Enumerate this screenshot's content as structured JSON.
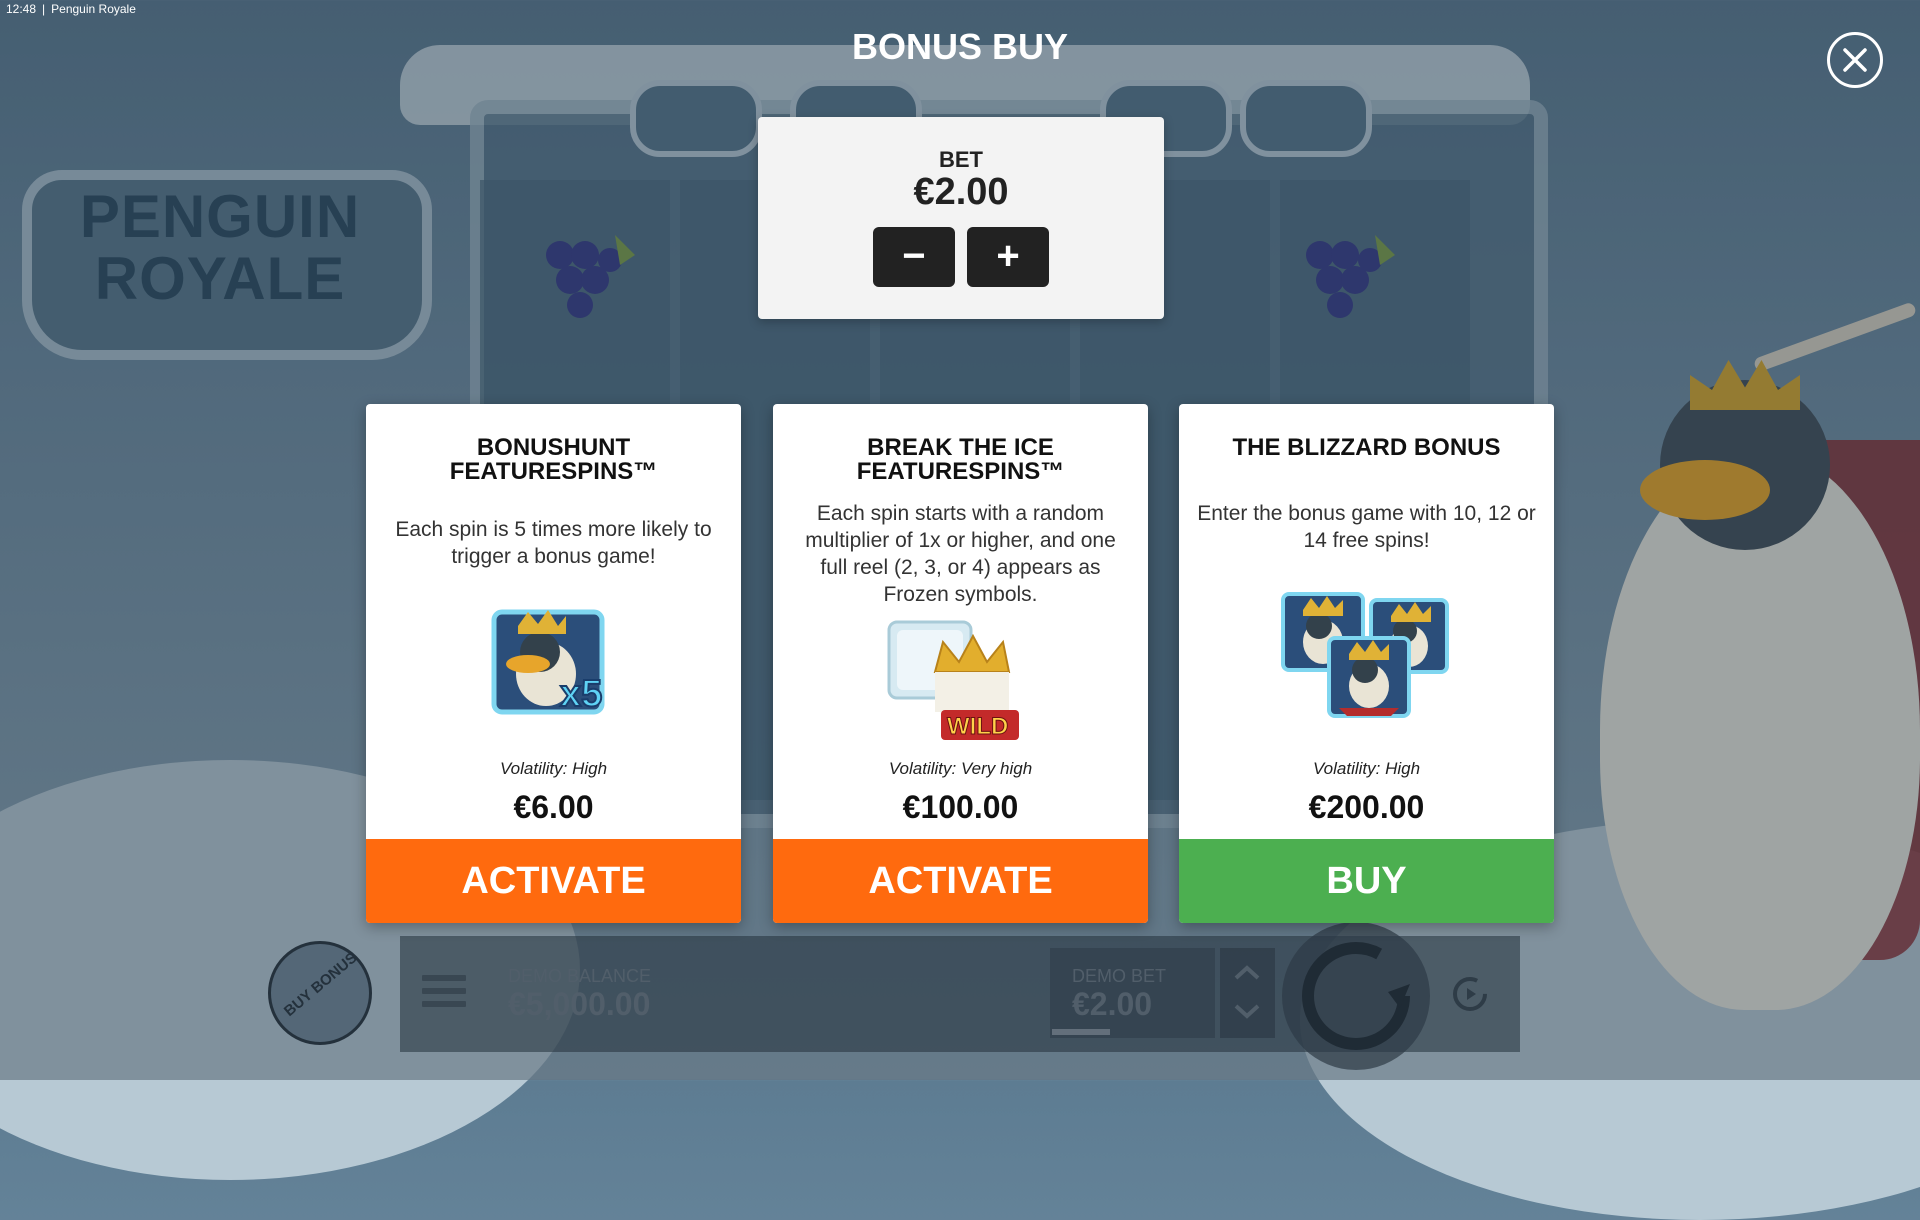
{
  "status_bar": {
    "time": "12:48",
    "separator": "|",
    "app_name": "Penguin Royale"
  },
  "background": {
    "logo_text": "PENGUIN ROYALE"
  },
  "modal": {
    "title": "BONUS BUY",
    "bet": {
      "label": "BET",
      "value": "€2.00",
      "decrease": "−",
      "increase": "+"
    },
    "cards": [
      {
        "title": "BONUSHUNT FEATURESPINS™",
        "description": "Each spin is 5 times more likely to trigger a bonus game!",
        "image_badge": "x5",
        "volatility": "Volatility: High",
        "price": "€6.00",
        "button": "ACTIVATE",
        "button_color": "#ff6a0e"
      },
      {
        "title": "BREAK THE ICE FEATURESPINS™",
        "description": "Each spin starts with a random multiplier of 1x or higher, and one full reel (2, 3, or 4) appears as Frozen symbols.",
        "image_badge": "WILD",
        "volatility": "Volatility: Very high",
        "price": "€100.00",
        "button": "ACTIVATE",
        "button_color": "#ff6a0e"
      },
      {
        "title": "THE BLIZZARD BONUS",
        "description": "Enter the bonus game with 10, 12 or 14 free spins!",
        "volatility": "Volatility: High",
        "price": "€200.00",
        "button": "BUY",
        "button_color": "#4caf50"
      }
    ]
  },
  "bottom_bar": {
    "buy_bonus": "BUY BONUS",
    "balance_label": "DEMO BALANCE",
    "balance_value": "€5,000.00",
    "bet_label": "DEMO BET",
    "bet_value": "€2.00"
  }
}
